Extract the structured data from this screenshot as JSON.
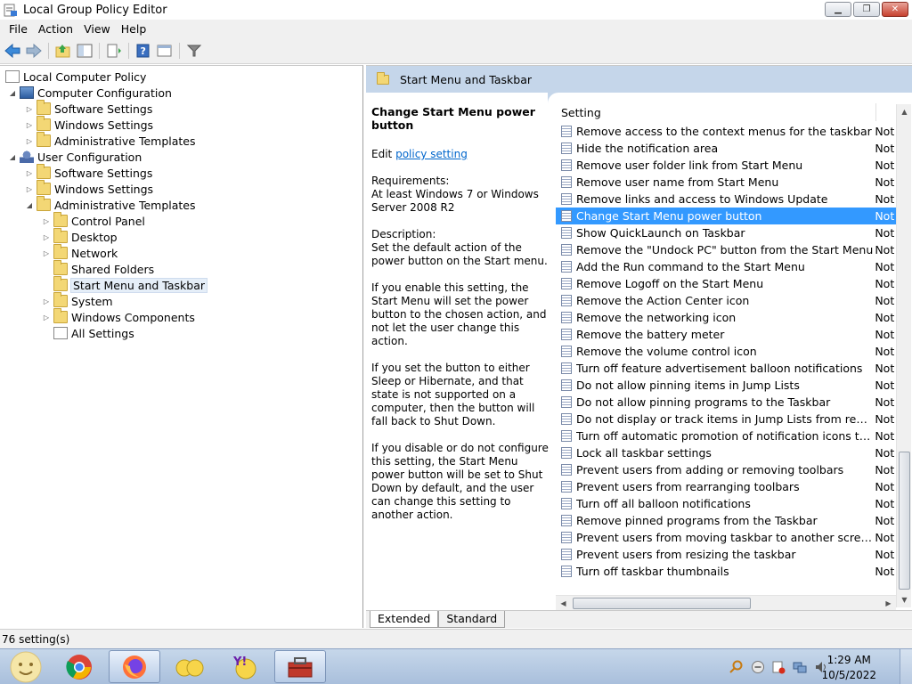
{
  "window": {
    "title": "Local Group Policy Editor"
  },
  "menubar": [
    "File",
    "Action",
    "View",
    "Help"
  ],
  "tree": {
    "root": "Local Computer Policy",
    "computer_config": "Computer Configuration",
    "cc_software": "Software Settings",
    "cc_windows": "Windows Settings",
    "cc_admin": "Administrative Templates",
    "user_config": "User Configuration",
    "uc_software": "Software Settings",
    "uc_windows": "Windows Settings",
    "uc_admin": "Administrative Templates",
    "control_panel": "Control Panel",
    "desktop": "Desktop",
    "network": "Network",
    "shared_folders": "Shared Folders",
    "start_menu": "Start Menu and Taskbar",
    "system": "System",
    "windows_components": "Windows Components",
    "all_settings": "All Settings"
  },
  "rightpane": {
    "header": "Start Menu and Taskbar",
    "desc_title": "Change Start Menu power button",
    "edit_prefix": "Edit",
    "edit_link": "policy setting",
    "requirements_label": "Requirements:",
    "requirements": "At least Windows 7 or Windows Server 2008 R2",
    "description_label": "Description:",
    "description": "Set the default action of the power button on the Start menu.",
    "para1": "If you enable this setting, the Start Menu will set the power button to the chosen action, and not let the user change this action.",
    "para2": "If you set the button to either Sleep or Hibernate, and that state is not supported on a computer, then the button will fall back to Shut Down.",
    "para3": "If you disable or do not configure this setting, the Start Menu power button will be set to Shut Down by default, and the user can change this setting to another action."
  },
  "list": {
    "col_setting": "Setting",
    "col_state": "",
    "selected_index": 5,
    "rows": [
      {
        "name": "Remove access to the context menus for the taskbar",
        "state": "Not"
      },
      {
        "name": "Hide the notification area",
        "state": "Not"
      },
      {
        "name": "Remove user folder link from Start Menu",
        "state": "Not"
      },
      {
        "name": "Remove user name from Start Menu",
        "state": "Not"
      },
      {
        "name": "Remove links and access to Windows Update",
        "state": "Not"
      },
      {
        "name": "Change Start Menu power button",
        "state": "Not"
      },
      {
        "name": "Show QuickLaunch on Taskbar",
        "state": "Not"
      },
      {
        "name": "Remove the \"Undock PC\" button from the Start Menu",
        "state": "Not"
      },
      {
        "name": "Add the Run command to the Start Menu",
        "state": "Not"
      },
      {
        "name": "Remove Logoff on the Start Menu",
        "state": "Not"
      },
      {
        "name": "Remove the Action Center icon",
        "state": "Not"
      },
      {
        "name": "Remove the networking icon",
        "state": "Not"
      },
      {
        "name": "Remove the battery meter",
        "state": "Not"
      },
      {
        "name": "Remove the volume control icon",
        "state": "Not"
      },
      {
        "name": "Turn off feature advertisement balloon notifications",
        "state": "Not"
      },
      {
        "name": "Do not allow pinning items in Jump Lists",
        "state": "Not"
      },
      {
        "name": "Do not allow pinning programs to the Taskbar",
        "state": "Not"
      },
      {
        "name": "Do not display or track items in Jump Lists from remote loca...",
        "state": "Not"
      },
      {
        "name": "Turn off automatic promotion of notification icons to the ta...",
        "state": "Not"
      },
      {
        "name": "Lock all taskbar settings",
        "state": "Not"
      },
      {
        "name": "Prevent users from adding or removing toolbars",
        "state": "Not"
      },
      {
        "name": "Prevent users from rearranging toolbars",
        "state": "Not"
      },
      {
        "name": "Turn off all balloon notifications",
        "state": "Not"
      },
      {
        "name": "Remove pinned programs from the Taskbar",
        "state": "Not"
      },
      {
        "name": "Prevent users from moving taskbar to another screen dock l...",
        "state": "Not"
      },
      {
        "name": "Prevent users from resizing the taskbar",
        "state": "Not"
      },
      {
        "name": "Turn off taskbar thumbnails",
        "state": "Not"
      }
    ]
  },
  "tabs": [
    "Extended",
    "Standard"
  ],
  "status": "76 setting(s)",
  "clock": {
    "time": "1:29 AM",
    "date": "10/5/2022"
  }
}
